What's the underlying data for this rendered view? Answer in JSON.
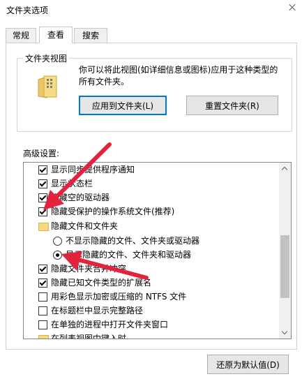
{
  "window": {
    "title": "文件夹选项"
  },
  "tabs": [
    {
      "label": "常规"
    },
    {
      "label": "查看"
    },
    {
      "label": "搜索"
    }
  ],
  "folder_views": {
    "legend": "文件夹视图",
    "description": "你可以将此视图(如详细信息或图标)应用于这种类型的所有文件夹。",
    "apply_button": "应用到文件夹(L)",
    "reset_button": "重置文件夹(R)"
  },
  "advanced": {
    "label": "高级设置:",
    "items": [
      {
        "type": "checkbox",
        "checked": true,
        "label": "显示同步提供程序通知"
      },
      {
        "type": "checkbox",
        "checked": true,
        "label": "显示状态栏"
      },
      {
        "type": "checkbox",
        "checked": true,
        "label": "隐藏空的驱动器"
      },
      {
        "type": "checkbox",
        "checked": true,
        "label": "隐藏受保护的操作系统文件(推荐)"
      },
      {
        "type": "folder",
        "label": "隐藏文件和文件夹"
      },
      {
        "type": "radio",
        "checked": false,
        "label": "不显示隐藏的文件、文件夹或驱动器"
      },
      {
        "type": "radio",
        "checked": true,
        "label": "显示隐藏的文件、文件夹和驱动器"
      },
      {
        "type": "checkbox",
        "checked": true,
        "label": "隐藏文件夹合并冲突"
      },
      {
        "type": "checkbox",
        "checked": true,
        "label": "隐藏已知文件类型的扩展名"
      },
      {
        "type": "checkbox",
        "checked": false,
        "label": "用彩色显示加密或压缩的 NTFS 文件"
      },
      {
        "type": "checkbox",
        "checked": false,
        "label": "在标题栏中显示完整路径"
      },
      {
        "type": "checkbox",
        "checked": false,
        "label": "在单独的进程中打开文件夹窗口"
      },
      {
        "type": "folder",
        "label": "在列表视图中键入时"
      }
    ]
  },
  "restore_button": "还原为默认值(D)",
  "icons": {
    "close": "close-icon",
    "folder_view": "folder-view-icon",
    "scroll_up": "chevron-up-icon",
    "scroll_down": "chevron-down-icon"
  },
  "colors": {
    "accent": "#0078d7",
    "arrow": "#e2233b",
    "folder": "#f5d97c"
  }
}
